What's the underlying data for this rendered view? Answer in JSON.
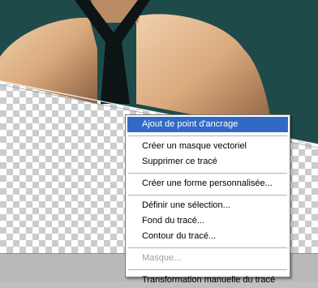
{
  "context_menu": {
    "items": [
      {
        "label": "Ajout de point d'ancrage",
        "state": "highlighted"
      },
      {
        "separator": true
      },
      {
        "label": "Créer un masque vectoriel",
        "state": "enabled"
      },
      {
        "label": "Supprimer ce tracé",
        "state": "enabled"
      },
      {
        "separator": true
      },
      {
        "label": "Créer une forme personnalisée...",
        "state": "enabled"
      },
      {
        "separator": true
      },
      {
        "label": "Définir une sélection...",
        "state": "enabled"
      },
      {
        "label": "Fond du tracé...",
        "state": "enabled"
      },
      {
        "label": "Contour du tracé...",
        "state": "enabled"
      },
      {
        "separator": true
      },
      {
        "label": "Masque...",
        "state": "disabled"
      },
      {
        "separator": true
      },
      {
        "label": "Transformation manuelle du tracé",
        "state": "enabled"
      }
    ],
    "highlight_color": "#316ac5",
    "disabled_color": "#a0a0a0"
  },
  "canvas": {
    "transparency_pattern": "checkerboard",
    "checker_colors": [
      "#ffffff",
      "#cccccc"
    ]
  },
  "photo": {
    "subject": "woman-shoulders-black-halter-top",
    "background_color": "#1f4a4a"
  }
}
